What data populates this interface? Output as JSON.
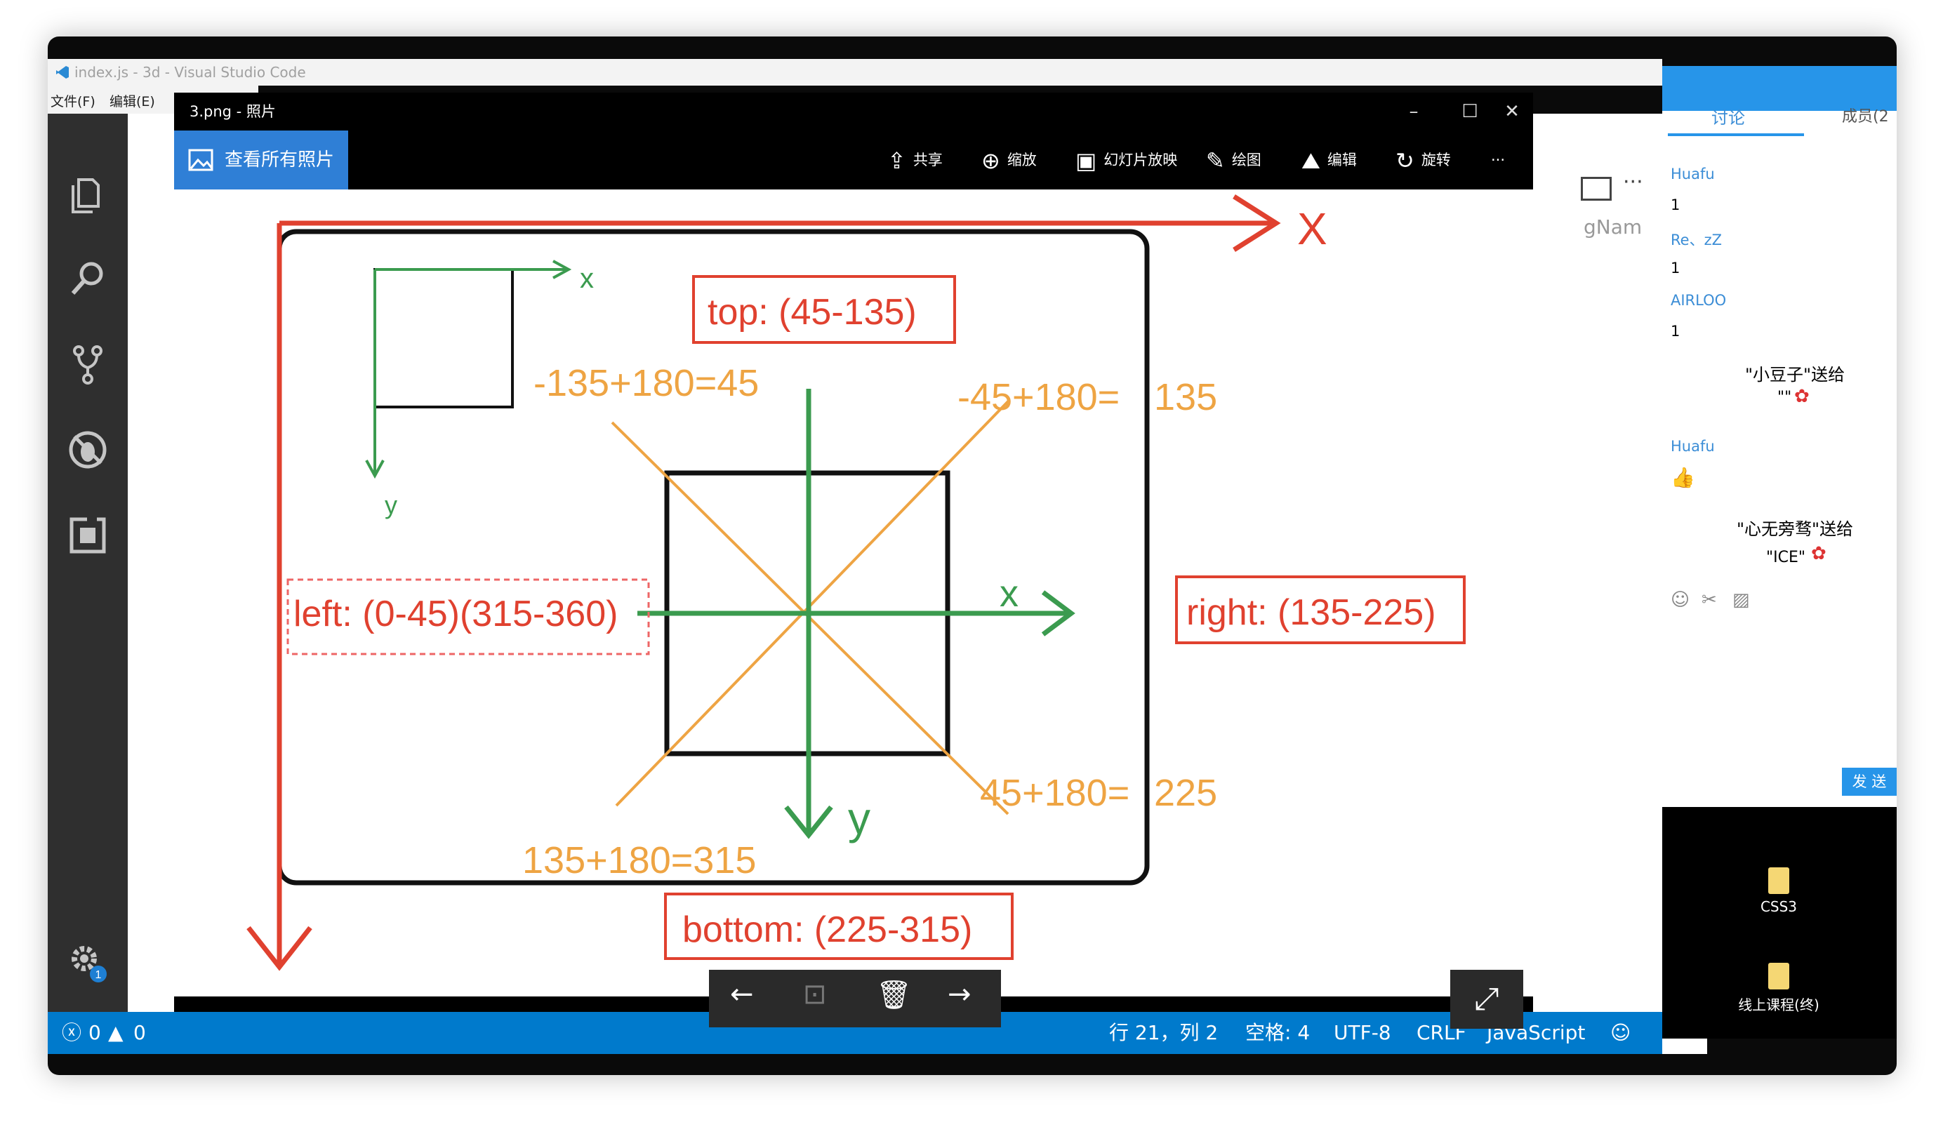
{
  "vscode": {
    "window_title": "index.js - 3d - Visual Studio Code",
    "menu": [
      "文件(F)",
      "编辑(E)"
    ],
    "status": {
      "errors": "0",
      "warnings": "0",
      "position": "行 21，列 2",
      "spaces": "空格: 4",
      "encoding": "UTF-8",
      "eol": "CRLF",
      "language": "JavaScript"
    },
    "settings_badge": "1",
    "editor_fragment": "gNam"
  },
  "photos": {
    "title": "3.png - 照片",
    "see_all": "查看所有照片",
    "toolbar": [
      {
        "label": "共享",
        "icon": "share-icon"
      },
      {
        "label": "缩放",
        "icon": "zoom-icon"
      },
      {
        "label": "幻灯片放映",
        "icon": "slideshow-icon"
      },
      {
        "label": "绘图",
        "icon": "draw-icon"
      },
      {
        "label": "编辑",
        "icon": "edit-icon"
      },
      {
        "label": "旋转",
        "icon": "rotate-icon"
      }
    ],
    "more": "···"
  },
  "diagram": {
    "axis_x_big": "X",
    "axis_small_x": "x",
    "axis_small_y": "y",
    "center_x": "x",
    "center_y": "y",
    "top": "top: (45-135)",
    "right": "right: (135-225)",
    "bottom": "bottom: (225-315)",
    "left": "left: (0-45)(315-360)",
    "eq_tl": "-135+180=45",
    "eq_tr_a": "-45+180=",
    "eq_tr_b": "135",
    "eq_br_a": "45+180=",
    "eq_br_b": "225",
    "eq_bl": "135+180=315",
    "colors": {
      "red": "#e0412f",
      "green": "#3b9b4f",
      "orange": "#eea443",
      "black": "#111111"
    }
  },
  "chat": {
    "tab": "讨论",
    "members": "成员(2",
    "messages": [
      {
        "name": "Huafu",
        "text": "1"
      },
      {
        "name": "Re、zZ",
        "text": "1"
      },
      {
        "name": "AIRLOO",
        "text": "1"
      }
    ],
    "gift1": "\"小豆子\"送给",
    "gift1_b": "\"\"",
    "name4": "Huafu",
    "gift2": "\"心无旁骛\"送给",
    "gift2_b": "\"ICE\"",
    "send": "发 送"
  },
  "desktop": {
    "icons": [
      "CSS3",
      "线上课程(终)"
    ]
  }
}
